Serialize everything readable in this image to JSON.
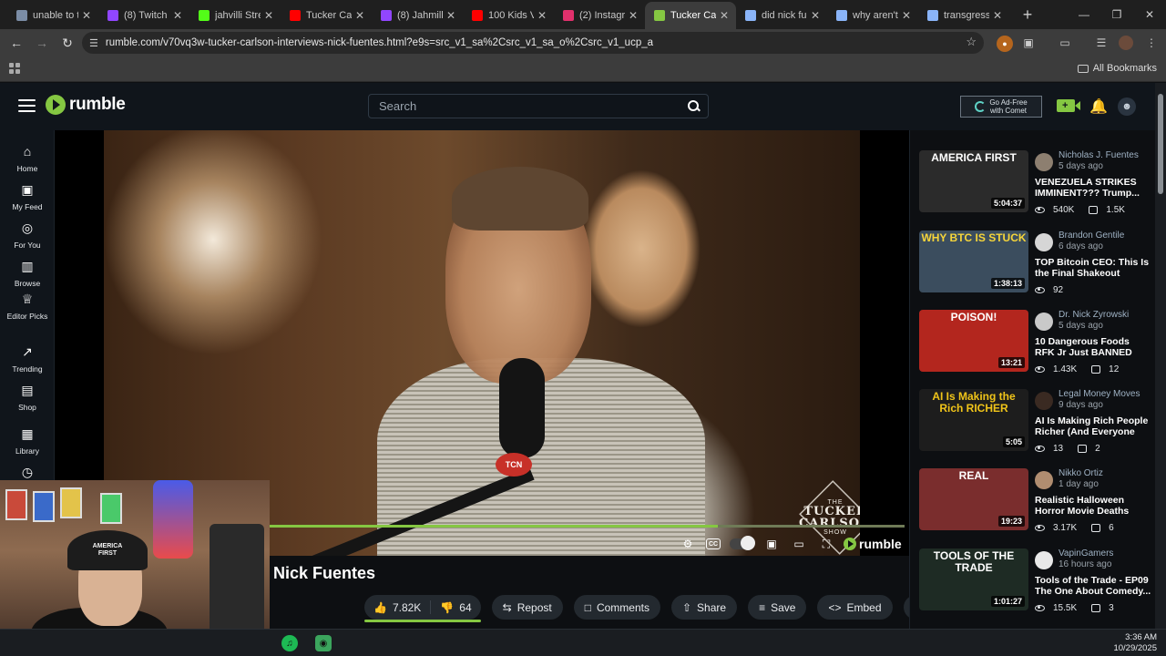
{
  "browser": {
    "tabs": [
      {
        "title": "unable to ty",
        "fav_color": "#7b8da6",
        "active": false
      },
      {
        "title": "(8) Twitch",
        "fav_color": "#9146ff",
        "active": false
      },
      {
        "title": "jahvilli Strea",
        "fav_color": "#53fc18",
        "active": false
      },
      {
        "title": "Tucker Carls",
        "fav_color": "#ff0000",
        "active": false
      },
      {
        "title": "(8) Jahmilli",
        "fav_color": "#9146ff",
        "active": false
      },
      {
        "title": "100 Kids Ve",
        "fav_color": "#ff0000",
        "active": false
      },
      {
        "title": "(2) Instagra",
        "fav_color": "#e1306c",
        "active": false
      },
      {
        "title": "Tucker Carl",
        "fav_color": "#85c742",
        "active": true
      },
      {
        "title": "did nick fue",
        "fav_color": "#8ab4f8",
        "active": false
      },
      {
        "title": "why aren't t",
        "fav_color": "#8ab4f8",
        "active": false
      },
      {
        "title": "transgressio",
        "fav_color": "#8ab4f8",
        "active": false
      }
    ],
    "url": "rumble.com/v70vq3w-tucker-carlson-interviews-nick-fuentes.html?e9s=src_v1_sa%2Csrc_v1_sa_o%2Csrc_v1_ucp_a",
    "all_bookmarks": "All Bookmarks"
  },
  "rumble": {
    "logo_text": "rumble",
    "search_placeholder": "Search",
    "adfree_line1": "Go Ad-Free",
    "adfree_line2": "with Comet",
    "accent": "#85c742",
    "nav": [
      {
        "label": "Home",
        "icon": "home-icon"
      },
      {
        "label": "My Feed",
        "icon": "feed-icon"
      },
      {
        "label": "For You",
        "icon": "for-you-icon"
      },
      {
        "label": "Browse",
        "icon": "browse-icon"
      },
      {
        "label": "Editor Picks",
        "icon": "editor-picks-icon"
      },
      {
        "label": "Trending",
        "icon": "trending-icon"
      },
      {
        "label": "Shop",
        "icon": "shop-icon"
      },
      {
        "label": "Library",
        "icon": "library-icon"
      }
    ],
    "video": {
      "title": "Nick Fuentes",
      "likes": "7.82K",
      "dislikes": "64",
      "watermark_top": "THE",
      "watermark_mid": "TUCKER CARLSON",
      "watermark_bottom": "SHOW",
      "mic_badge": "TCN",
      "player_logo": "rumble",
      "progress_fraction": 0.73
    },
    "actions": [
      "Repost",
      "Comments",
      "Share",
      "Save",
      "Embed"
    ],
    "recommended": [
      {
        "channel": "Nicholas J. Fuentes",
        "age": "5 days ago",
        "title": "VENEZUELA STRIKES IMMINENT??? Trump...",
        "views": "540K",
        "comments": "1.5K",
        "duration": "5:04:37",
        "thumb_text": "AMERICA FIRST",
        "thumb_bg": "#2b2b2b",
        "thumb_fg": "#ffffff",
        "avatar": "#8d7f70"
      },
      {
        "channel": "Brandon Gentile",
        "age": "6 days ago",
        "title": "TOP Bitcoin CEO: This Is the Final Shakeout Befor...",
        "views": "92",
        "comments": "",
        "duration": "1:38:13",
        "thumb_text": "WHY BTC IS STUCK",
        "thumb_bg": "#3b4d5e",
        "thumb_fg": "#f6d53a",
        "avatar": "#d6d6d6"
      },
      {
        "channel": "Dr. Nick Zyrowski",
        "age": "5 days ago",
        "title": "10 Dangerous Foods RFK Jr Just BANNED",
        "views": "1.43K",
        "comments": "12",
        "duration": "13:21",
        "thumb_text": "POISON!",
        "thumb_bg": "#b3261e",
        "thumb_fg": "#ffffff",
        "avatar": "#c9c9c9"
      },
      {
        "channel": "Legal Money Moves",
        "age": "9 days ago",
        "title": "AI Is Making Rich People Richer (And Everyone El...",
        "views": "13",
        "comments": "2",
        "duration": "5:05",
        "thumb_text": "AI Is Making the Rich RICHER",
        "thumb_bg": "#1d1d1d",
        "thumb_fg": "#f0c419",
        "avatar": "#3a2a22"
      },
      {
        "channel": "Nikko Ortiz",
        "age": "1 day ago",
        "title": "Realistic Halloween Horror Movie Deaths",
        "views": "3.17K",
        "comments": "6",
        "duration": "19:23",
        "thumb_text": "REAL",
        "thumb_bg": "#7a2d2d",
        "thumb_fg": "#ffffff",
        "avatar": "#b08d70"
      },
      {
        "channel": "VapinGamers",
        "age": "16 hours ago",
        "title": "Tools of the Trade - EP09 The One About Comedy...",
        "views": "15.5K",
        "comments": "3",
        "duration": "1:01:27",
        "thumb_text": "TOOLS OF THE TRADE",
        "thumb_bg": "#1e2b24",
        "thumb_fg": "#ffffff",
        "avatar": "#e8e8e8"
      }
    ]
  },
  "taskbar": {
    "time": "3:36 AM",
    "date": "10/29/2025"
  }
}
